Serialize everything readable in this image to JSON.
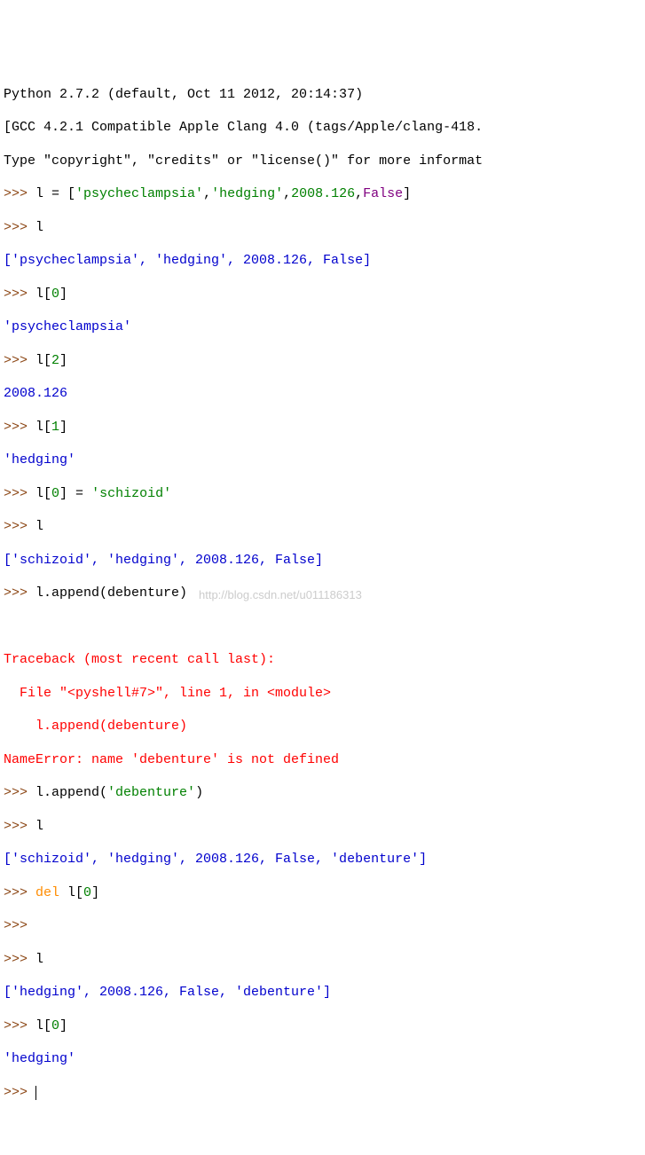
{
  "header": {
    "line1": "Python 2.7.2 (default, Oct 11 2012, 20:14:37)",
    "line2": "[GCC 4.2.1 Compatible Apple Clang 4.0 (tags/Apple/clang-418.",
    "line3": "Type \"copyright\", \"credits\" or \"license()\" for more informat"
  },
  "p": ">>> ",
  "l1": {
    "a": "l = [",
    "s1": "'psycheclampsia'",
    "c1": ",",
    "s2": "'hedging'",
    "c2": ",",
    "n1": "2008.126",
    "c3": ",",
    "k1": "False",
    "b": "]"
  },
  "l2": "l",
  "o1": "['psycheclampsia', 'hedging', 2008.126, False]",
  "l3": {
    "a": "l[",
    "n": "0",
    "b": "]"
  },
  "o2": "'psycheclampsia'",
  "l4": {
    "a": "l[",
    "n": "2",
    "b": "]"
  },
  "o3": "2008.126",
  "l5": {
    "a": "l[",
    "n": "1",
    "b": "]"
  },
  "o4": "'hedging'",
  "l6": {
    "a": "l[",
    "n": "0",
    "b": "] = ",
    "s": "'schizoid'"
  },
  "l7": "l",
  "o5": "['schizoid', 'hedging', 2008.126, False]",
  "l8": "l.append(debenture)",
  "err": {
    "e1": "Traceback (most recent call last):",
    "e2": "  File \"<pyshell#7>\", line 1, in <module>",
    "e3": "    l.append(debenture)",
    "e4": "NameError: name 'debenture' is not defined"
  },
  "l9": {
    "a": "l.append(",
    "s": "'debenture'",
    "b": ")"
  },
  "l10": "l",
  "o6": "['schizoid', 'hedging', 2008.126, False, 'debenture']",
  "l11": {
    "k": "del",
    "a": " l[",
    "n": "0",
    "b": "]"
  },
  "l12": "l",
  "o7": "['hedging', 2008.126, False, 'debenture']",
  "l13": {
    "a": "l[",
    "n": "0",
    "b": "]"
  },
  "o8": "'hedging'",
  "watermark": "http://blog.csdn.net/u011186313"
}
